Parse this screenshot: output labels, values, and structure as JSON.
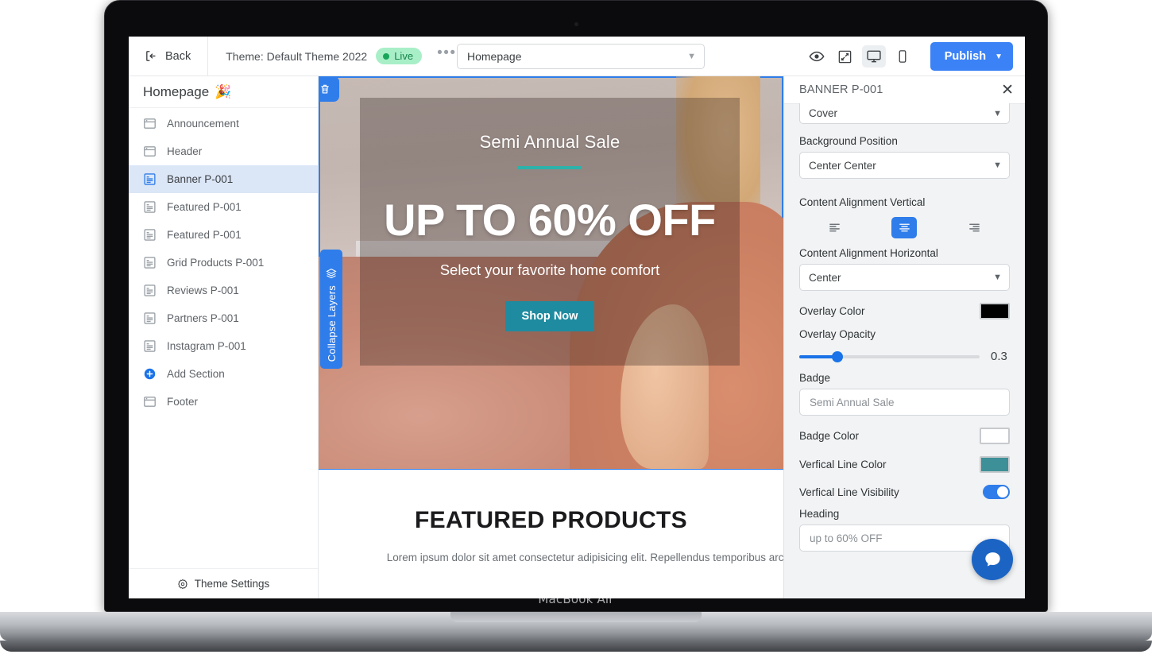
{
  "device": {
    "model_label": "MacBook Air"
  },
  "toolbar": {
    "back_label": "Back",
    "theme_label": "Theme: Default Theme 2022",
    "live_label": "Live",
    "more_label": "•••",
    "page_selected": "Homepage",
    "publish_label": "Publish",
    "icons": {
      "preview": "eye-icon",
      "fullscreen": "expand-icon",
      "desktop": "desktop-icon",
      "mobile": "mobile-icon"
    }
  },
  "sidebar": {
    "title": "Homepage",
    "title_emoji": "🎉",
    "footer_label": "Theme Settings",
    "items": [
      {
        "label": "Announcement",
        "icon": "window-icon",
        "selected": false
      },
      {
        "label": "Header",
        "icon": "window-icon",
        "selected": false
      },
      {
        "label": "Banner P-001",
        "icon": "section-icon",
        "selected": true
      },
      {
        "label": "Featured P-001",
        "icon": "section-icon",
        "selected": false
      },
      {
        "label": "Featured P-001",
        "icon": "section-icon",
        "selected": false
      },
      {
        "label": "Grid Products P-001",
        "icon": "section-icon",
        "selected": false
      },
      {
        "label": "Reviews P-001",
        "icon": "section-icon",
        "selected": false
      },
      {
        "label": "Partners P-001",
        "icon": "section-icon",
        "selected": false
      },
      {
        "label": "Instagram P-001",
        "icon": "section-icon",
        "selected": false
      },
      {
        "label": "Add Section",
        "icon": "plus-circle-icon",
        "selected": false
      },
      {
        "label": "Footer",
        "icon": "window-icon",
        "selected": false
      }
    ]
  },
  "canvas": {
    "delete_tab_icon": "trash-icon",
    "collapse_tab_label": "Collapse Layers",
    "collapse_tab_icon": "layers-icon",
    "banner": {
      "badge": "Semi Annual Sale",
      "heading": "UP TO 60% OFF",
      "subheading": "Select your favorite home comfort",
      "cta_label": "Shop Now",
      "line_color": "#2bb3ab",
      "cta_color": "#1f8ba0"
    },
    "featured": {
      "title": "FEATURED PRODUCTS",
      "description": "Lorem ipsum dolor sit amet consectetur adipisicing elit. Repellendus temporibus architecto fugit consectetur assumenda earum tenetur in. Architecto!"
    }
  },
  "panel": {
    "title": "BANNER P-001",
    "close_icon": "close-icon",
    "background_size_value": "Cover",
    "background_position_label": "Background Position",
    "background_position_value": "Center Center",
    "content_align_vertical_label": "Content Alignment Vertical",
    "align_options": [
      {
        "name": "align-top",
        "active": false
      },
      {
        "name": "align-middle",
        "active": true
      },
      {
        "name": "align-bottom",
        "active": false
      }
    ],
    "content_align_horizontal_label": "Content Alignment Horizontal",
    "content_align_horizontal_value": "Center",
    "overlay_color_label": "Overlay Color",
    "overlay_color_value": "#000000",
    "overlay_opacity_label": "Overlay Opacity",
    "overlay_opacity_value": "0.3",
    "overlay_opacity_percent": 21,
    "badge_label": "Badge",
    "badge_value": "Semi Annual Sale",
    "badge_color_label": "Badge Color",
    "badge_color_value": "#ffffff",
    "vertical_line_color_label": "Verfical Line Color",
    "vertical_line_color_value": "#3d9097",
    "vertical_line_visibility_label": "Verfical Line Visibility",
    "vertical_line_visibility_on": true,
    "heading_label": "Heading",
    "heading_value": "up to 60% OFF",
    "chat_icon": "chat-bubble-icon"
  }
}
